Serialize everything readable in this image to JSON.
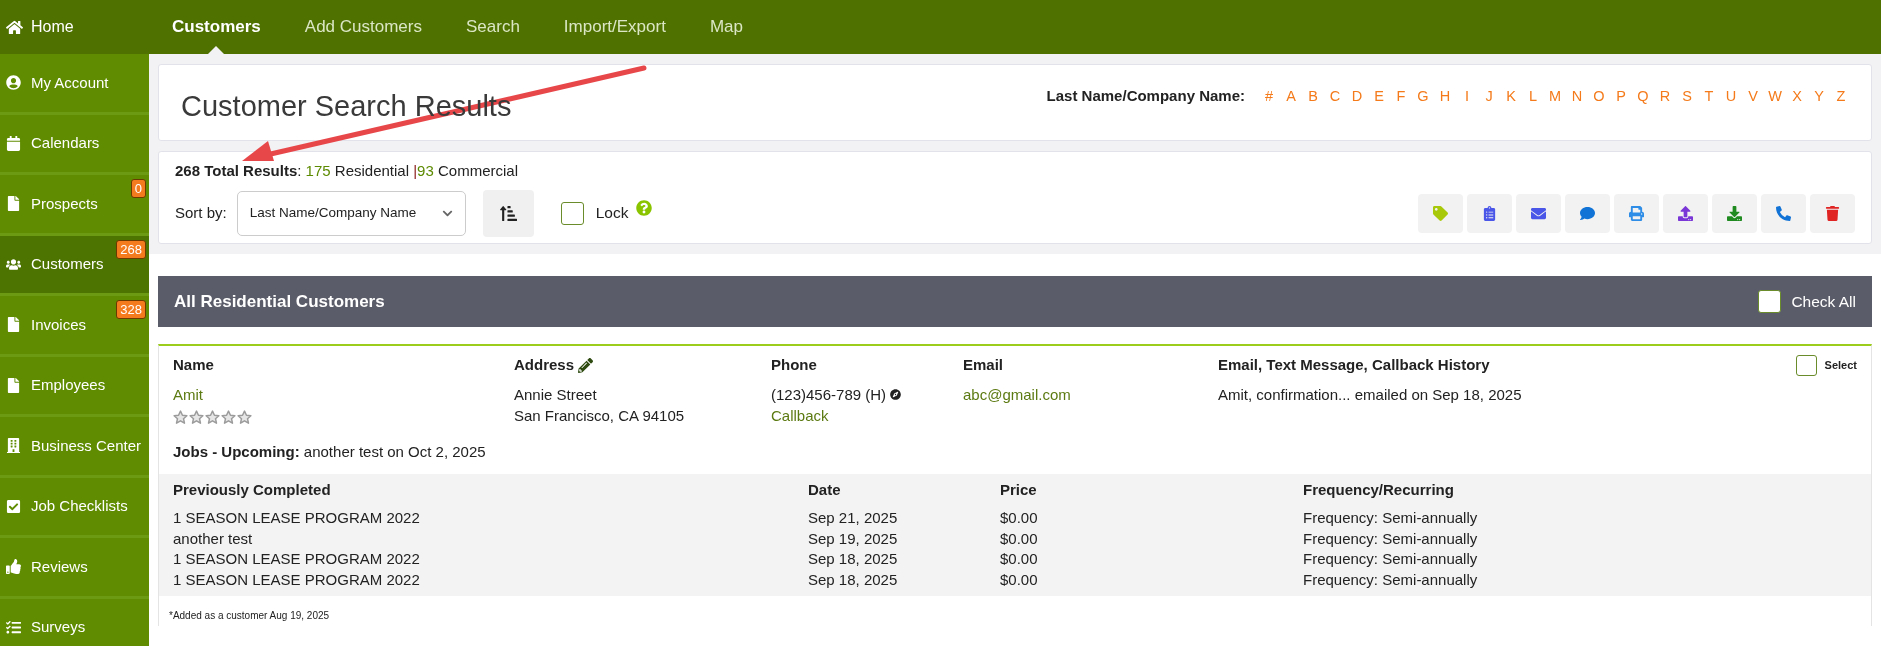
{
  "top_nav": {
    "home": "Home",
    "tabs": [
      {
        "label": "Customers",
        "selected": true
      },
      {
        "label": "Add Customers",
        "selected": false
      },
      {
        "label": "Search",
        "selected": false
      },
      {
        "label": "Import/Export",
        "selected": false
      },
      {
        "label": "Map",
        "selected": false
      }
    ]
  },
  "sidebar": {
    "items": [
      {
        "label": "My Account",
        "selected": false
      },
      {
        "label": "Calendars",
        "selected": false
      },
      {
        "label": "Prospects",
        "badge": "0",
        "selected": false
      },
      {
        "label": "Customers",
        "badge": "268",
        "selected": true
      },
      {
        "label": "Invoices",
        "badge": "328",
        "selected": false
      },
      {
        "label": "Employees",
        "selected": false
      },
      {
        "label": "Business Center",
        "selected": false
      },
      {
        "label": "Job Checklists",
        "selected": false
      },
      {
        "label": "Reviews",
        "selected": false
      },
      {
        "label": "Surveys",
        "selected": false
      }
    ]
  },
  "page_title": "Customer Search Results",
  "letter_filter": {
    "label": "Last Name/Company Name:",
    "letters": [
      "#",
      "A",
      "B",
      "C",
      "D",
      "E",
      "F",
      "G",
      "H",
      "I",
      "J",
      "K",
      "L",
      "M",
      "N",
      "O",
      "P",
      "Q",
      "R",
      "S",
      "T",
      "U",
      "V",
      "W",
      "X",
      "Y",
      "Z"
    ]
  },
  "results": {
    "total": "**268 Total Results**:",
    "residential_count": "175",
    "residential_label": "Residential",
    "separator": "|",
    "commercial_count": "93",
    "commercial_label": "Commercial"
  },
  "sort": {
    "label": "Sort by:",
    "value": "Last Name/Company Name",
    "lock_label": "Lock",
    "lock_checked": false
  },
  "section": {
    "title": "All Residential Customers",
    "check_all_label": "Check All",
    "check_all_checked": false
  },
  "customer": {
    "columns": [
      "Name",
      "Address",
      "Phone",
      "Email",
      "Email, Text Message, Callback History"
    ],
    "select_label": "Select",
    "selected": false,
    "name": "Amit",
    "stars": 0,
    "address": [
      "Annie Street",
      "San Francisco, CA 94105"
    ],
    "phone": "(123)456-789 (H)",
    "callback": "Callback",
    "email": "abc@gmail.com",
    "history": "Amit, confirmation... emailed on Sep 18, 2025",
    "upcoming_label": "Jobs - Upcoming:",
    "upcoming": "another test on Oct 2, 2025",
    "jobs_columns": [
      "Previously Completed",
      "Date",
      "Price",
      "Frequency/Recurring"
    ],
    "jobs": [
      [
        "1 SEASON LEASE PROGRAM 2022",
        "Sep 21, 2025",
        "$0.00",
        "Frequency: Semi-annually"
      ],
      [
        "another test",
        "Sep 19, 2025",
        "$0.00",
        "Frequency: Semi-annually"
      ],
      [
        "1 SEASON LEASE PROGRAM 2022",
        "Sep 18, 2025",
        "$0.00",
        "Frequency: Semi-annually"
      ],
      [
        "1 SEASON LEASE PROGRAM 2022",
        "Sep 18, 2025",
        "$0.00",
        "Frequency: Semi-annually"
      ]
    ],
    "added_note": "*Added as a customer Aug 19, 2025"
  }
}
